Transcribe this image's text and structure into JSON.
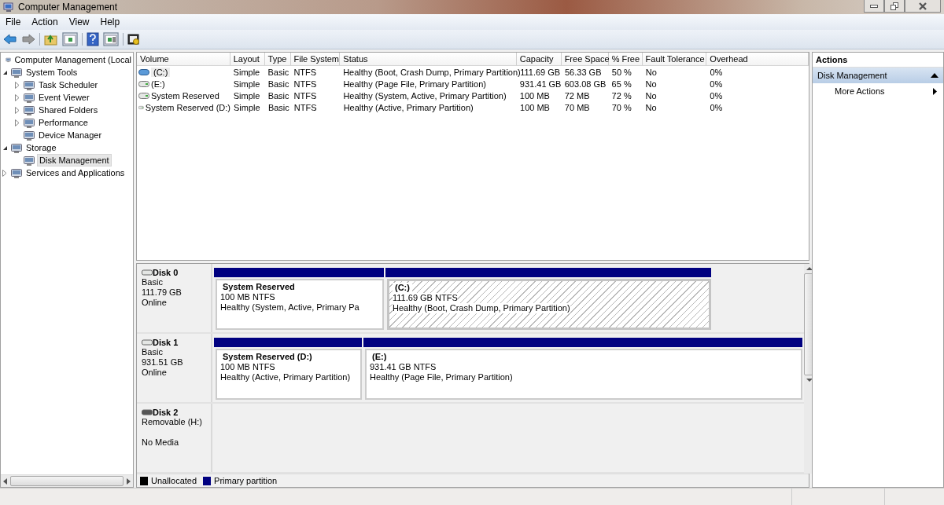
{
  "window": {
    "title": "Computer Management"
  },
  "menu": [
    "File",
    "Action",
    "View",
    "Help"
  ],
  "tree": [
    {
      "label": "Computer Management (Local",
      "selected": false,
      "children": [
        {
          "label": "System Tools",
          "selected": false,
          "expanded": true,
          "children": [
            {
              "label": "Task Scheduler",
              "selected": false,
              "expanded": false
            },
            {
              "label": "Event Viewer",
              "selected": false,
              "expanded": false
            },
            {
              "label": "Shared Folders",
              "selected": false,
              "expanded": false
            },
            {
              "label": "Performance",
              "selected": false,
              "expanded": false
            },
            {
              "label": "Device Manager",
              "selected": false
            }
          ]
        },
        {
          "label": "Storage",
          "selected": false,
          "expanded": true,
          "children": [
            {
              "label": "Disk Management",
              "selected": true
            }
          ]
        },
        {
          "label": "Services and Applications",
          "selected": false,
          "expanded": false
        }
      ]
    }
  ],
  "volumes": {
    "columns": [
      "Volume",
      "Layout",
      "Type",
      "File System",
      "Status",
      "Capacity",
      "Free Space",
      "% Free",
      "Fault Tolerance",
      "Overhead"
    ],
    "rows": [
      {
        "kind": "boot",
        "selected": true,
        "cells": [
          "(C:)",
          "Simple",
          "Basic",
          "NTFS",
          "Healthy (Boot, Crash Dump, Primary Partition)",
          "111.69 GB",
          "56.33 GB",
          "50 %",
          "No",
          "0%"
        ]
      },
      {
        "kind": "data",
        "selected": false,
        "cells": [
          "(E:)",
          "Simple",
          "Basic",
          "NTFS",
          "Healthy (Page File, Primary Partition)",
          "931.41 GB",
          "603.08 GB",
          "65 %",
          "No",
          "0%"
        ]
      },
      {
        "kind": "data",
        "selected": false,
        "cells": [
          "System Reserved",
          "Simple",
          "Basic",
          "NTFS",
          "Healthy (System, Active, Primary Partition)",
          "100 MB",
          "72 MB",
          "72 %",
          "No",
          "0%"
        ]
      },
      {
        "kind": "data",
        "selected": false,
        "cells": [
          "System Reserved (D:)",
          "Simple",
          "Basic",
          "NTFS",
          "Healthy (Active, Primary Partition)",
          "100 MB",
          "70 MB",
          "70 %",
          "No",
          "0%"
        ]
      }
    ]
  },
  "disks": [
    {
      "name": "Disk 0",
      "type": "Basic",
      "size": "111.79 GB",
      "status": "Online",
      "partitions": [
        {
          "title": "System Reserved",
          "size": "100 MB NTFS",
          "status": "Healthy (System, Active, Primary Pa",
          "selected": false
        },
        {
          "title": "(C:)",
          "size": "111.69 GB NTFS",
          "status": "Healthy (Boot, Crash Dump, Primary Partition)",
          "selected": true
        }
      ]
    },
    {
      "name": "Disk 1",
      "type": "Basic",
      "size": "931.51 GB",
      "status": "Online",
      "partitions": [
        {
          "title": "System Reserved  (D:)",
          "size": "100 MB NTFS",
          "status": "Healthy (Active, Primary Partition)",
          "selected": false
        },
        {
          "title": "(E:)",
          "size": "931.41 GB NTFS",
          "status": "Healthy (Page File, Primary Partition)",
          "selected": false
        }
      ]
    },
    {
      "name": "Disk 2",
      "type": "Removable (H:)",
      "status": "No Media"
    }
  ],
  "legend": [
    {
      "label": "Unallocated",
      "color": "#000000"
    },
    {
      "label": "Primary partition",
      "color": "#000080"
    }
  ],
  "actions": {
    "title": "Actions",
    "sections": [
      {
        "label": "Disk Management",
        "expanded": true,
        "items": [
          "More Actions"
        ]
      }
    ]
  }
}
